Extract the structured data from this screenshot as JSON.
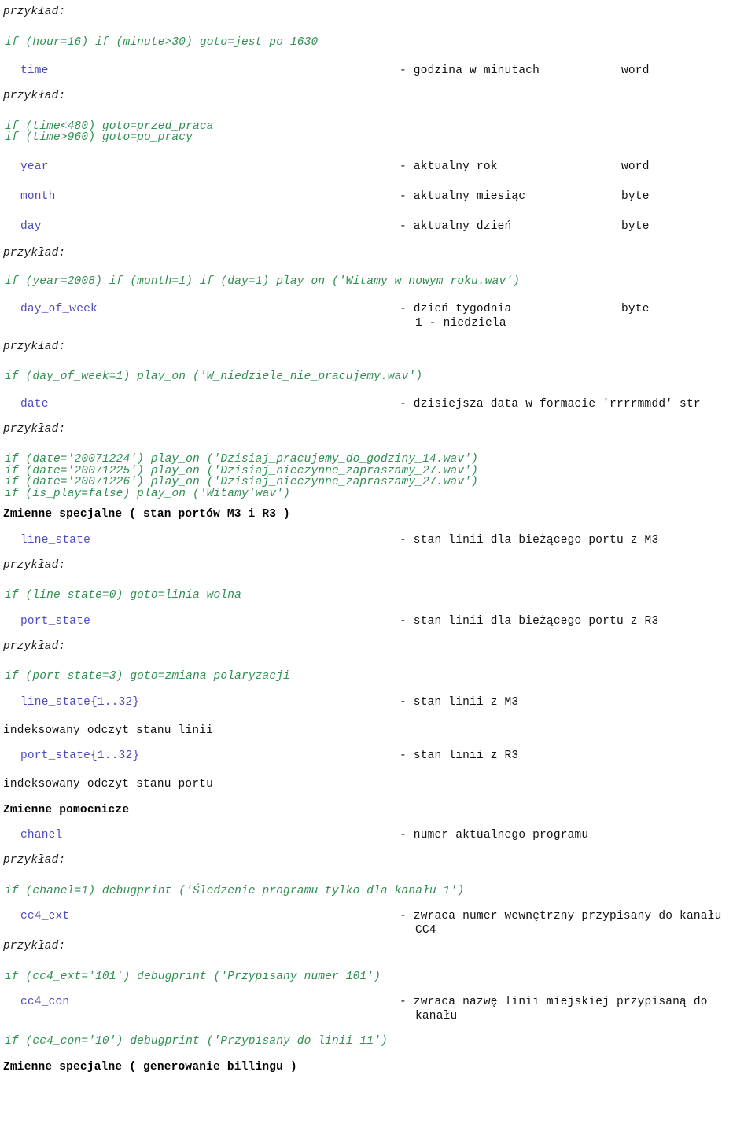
{
  "labels": {
    "example": "przykład:"
  },
  "colors": {
    "code_green": "#2f8f52",
    "variable_blue": "#4b4bbf",
    "text_black": "#111111",
    "background": "#ffffff"
  },
  "blocks": {
    "example_1": "przykład:",
    "code_1": "if (hour=16) if (minute>30) goto=jest_po_1630",
    "var_time": {
      "name": "time",
      "desc": "- godzina w minutach",
      "type": "word"
    },
    "example_2": "przykład:",
    "code_2a": "if (time<480) goto=przed_praca",
    "code_2b": "if (time>960) goto=po_pracy",
    "var_year": {
      "name": "year",
      "desc": "- aktualny rok",
      "type": "word"
    },
    "var_month": {
      "name": "month",
      "desc": "- aktualny miesiąc",
      "type": "byte"
    },
    "var_day": {
      "name": "day",
      "desc": "- aktualny dzień",
      "type": "byte"
    },
    "example_3": "przykład:",
    "code_3": "if (year=2008) if (month=1) if (day=1) play_on ('Witamy_w_nowym_roku.wav')",
    "var_day_of_week": {
      "name": "day_of_week",
      "desc": "- dzień tygodnia",
      "desc2": "1 - niedziela",
      "type": "byte"
    },
    "example_4": "przykład:",
    "code_4": "if (day_of_week=1) play_on ('W_niedziele_nie_pracujemy.wav')",
    "var_date": {
      "name": "date",
      "desc": "- dzisiejsza data w formacie 'rrrrmmdd' str",
      "type": ""
    },
    "example_5": "przykład:",
    "code_5a": "if (date='20071224') play_on ('Dzisiaj_pracujemy_do_godziny_14.wav')",
    "code_5b": "if (date='20071225') play_on ('Dzisiaj_nieczynne_zapraszamy_27.wav')",
    "code_5c": "if (date='20071226') play_on ('Dzisiaj_nieczynne_zapraszamy_27.wav')",
    "code_5d": "if (is_play=false) play_on ('Witamy'wav')",
    "heading_1": "Zmienne specjalne ( stan portów M3 i R3 )",
    "var_line_state": {
      "name": "line_state",
      "desc": "- stan linii dla bieżącego portu z M3",
      "type": ""
    },
    "example_6": "przykład:",
    "code_6": "if (line_state=0) goto=linia_wolna",
    "var_port_state": {
      "name": "port_state",
      "desc": "- stan linii dla bieżącego portu z R3",
      "type": ""
    },
    "example_7": "przykład:",
    "code_7": "if (port_state=3) goto=zmiana_polaryzacji",
    "var_line_state_idx": {
      "name": "line_state{1..32}",
      "desc": "- stan linii z M3",
      "type": ""
    },
    "note_1": "indeksowany odczyt stanu linii",
    "var_port_state_idx": {
      "name": "port_state{1..32}",
      "desc": "- stan linii z R3",
      "type": ""
    },
    "note_2": "indeksowany odczyt stanu portu",
    "heading_2": "Zmienne pomocnicze",
    "var_chanel": {
      "name": "chanel",
      "desc": "- numer aktualnego programu",
      "type": ""
    },
    "example_8": "przykład:",
    "code_8": "if (chanel=1) debugprint ('Śledzenie programu tylko dla kanału 1')",
    "var_cc4_ext": {
      "name": "cc4_ext",
      "desc": "- zwraca numer wewnętrzny przypisany do kanału",
      "desc2": "CC4",
      "type": ""
    },
    "example_9": "przykład:",
    "code_9": "if (cc4_ext='101') debugprint ('Przypisany numer 101')",
    "var_cc4_con": {
      "name": "cc4_con",
      "desc": "- zwraca nazwę linii miejskiej przypisaną do",
      "desc2": "kanału",
      "type": ""
    },
    "code_10": "if (cc4_con='10') debugprint ('Przypisany do linii 11')",
    "heading_3": "Zmienne specjalne ( generowanie billingu )"
  }
}
